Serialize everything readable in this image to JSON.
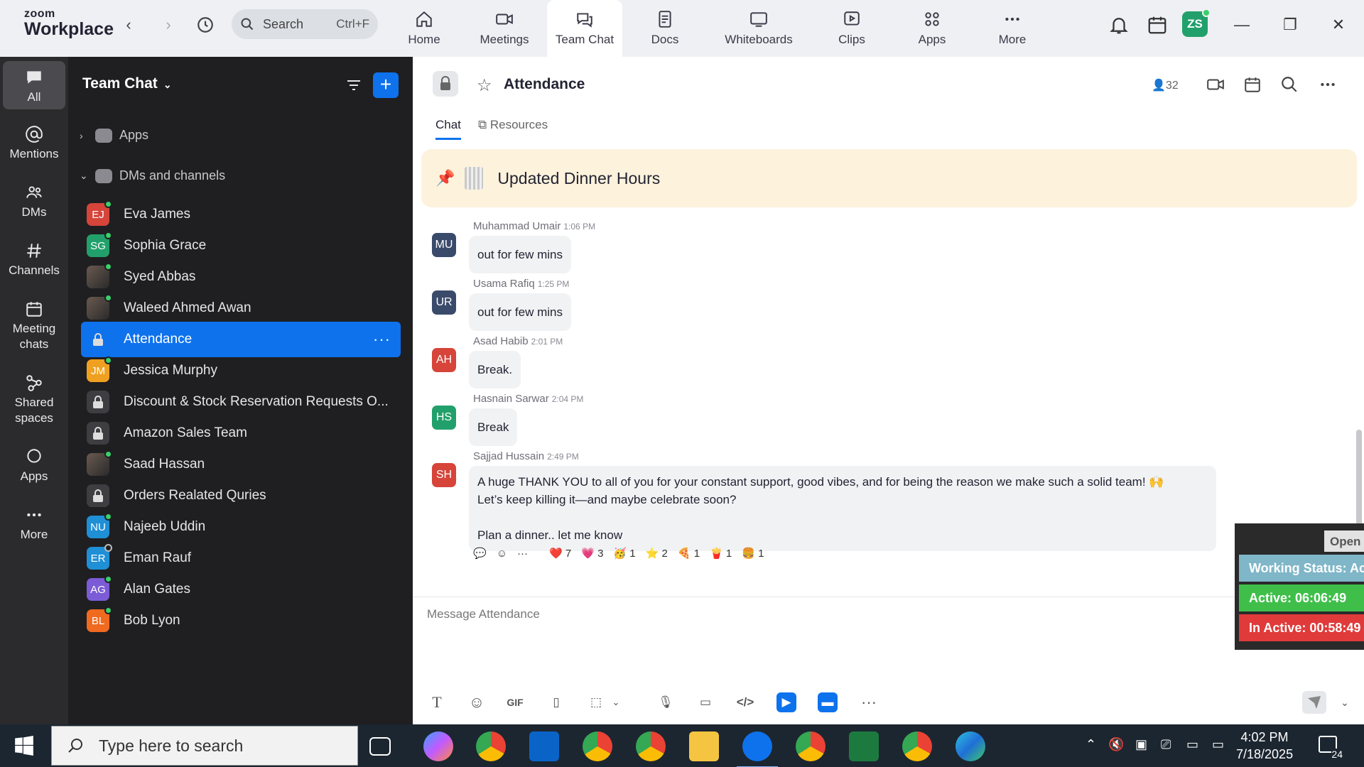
{
  "app": {
    "brand_top": "zoom",
    "brand_bottom": "Workplace"
  },
  "search": {
    "placeholder": "Search",
    "shortcut": "Ctrl+F"
  },
  "tabs": [
    {
      "label": "Home",
      "icon": "home-icon"
    },
    {
      "label": "Meetings",
      "icon": "video-camera-icon"
    },
    {
      "label": "Team Chat",
      "icon": "chat-bubble-icon",
      "active": true
    },
    {
      "label": "Docs",
      "icon": "document-icon"
    },
    {
      "label": "Whiteboards",
      "icon": "whiteboard-icon"
    },
    {
      "label": "Clips",
      "icon": "clip-icon"
    },
    {
      "label": "Apps",
      "icon": "apps-icon"
    },
    {
      "label": "More",
      "icon": "more-icon"
    }
  ],
  "user": {
    "initials": "ZS"
  },
  "rail": [
    {
      "label": "All"
    },
    {
      "label": "Mentions"
    },
    {
      "label": "DMs"
    },
    {
      "label": "Channels"
    },
    {
      "label": "Meeting chats"
    },
    {
      "label": "Shared spaces"
    },
    {
      "label": "Apps"
    },
    {
      "label": "More"
    }
  ],
  "sidebar": {
    "title": "Team Chat",
    "sections": {
      "apps": "Apps",
      "dms": "DMs and channels"
    },
    "items": [
      {
        "label": "Eva James",
        "initials": "EJ",
        "color": "#d6443a",
        "status": "online"
      },
      {
        "label": "Sophia Grace",
        "initials": "SG",
        "color": "#22a06b",
        "status": "online"
      },
      {
        "label": "Syed Abbas",
        "initials": "",
        "color": "#555",
        "status": "online",
        "photo": true
      },
      {
        "label": "Waleed Ahmed Awan",
        "initials": "",
        "color": "#555",
        "status": "online",
        "photo": true
      },
      {
        "label": "Attendance",
        "initials": "",
        "lock": true,
        "selected": true
      },
      {
        "label": "Jessica Murphy",
        "initials": "JM",
        "color": "#f0a020",
        "status": "online"
      },
      {
        "label": "Discount & Stock Reservation Requests O...",
        "initials": "",
        "lock": true
      },
      {
        "label": "Amazon Sales Team",
        "initials": "",
        "lock": true
      },
      {
        "label": "Saad Hassan",
        "initials": "",
        "color": "#555",
        "status": "online",
        "photo": true
      },
      {
        "label": "Orders Realated Quries",
        "initials": "",
        "lock": true
      },
      {
        "label": "Najeeb Uddin",
        "initials": "NU",
        "color": "#1f8fd6",
        "status": "online"
      },
      {
        "label": "Eman Rauf",
        "initials": "ER",
        "color": "#1f8fd6",
        "status": "offline"
      },
      {
        "label": "Alan Gates",
        "initials": "AG",
        "color": "#7b5cd6",
        "status": "online"
      },
      {
        "label": "Bob Lyon",
        "initials": "BL",
        "color": "#f06a20",
        "status": "online"
      }
    ]
  },
  "channel": {
    "title": "Attendance",
    "members": "32",
    "tabs": {
      "chat": "Chat",
      "resources": "Resources"
    },
    "pinned": "Updated Dinner Hours",
    "messages": [
      {
        "author": "Muhammad Umair",
        "time": "1:06 PM",
        "initials": "MU",
        "color": "#3a4a6a",
        "text": "out for few mins"
      },
      {
        "author": "Usama Rafiq",
        "time": "1:25 PM",
        "initials": "UR",
        "color": "#3a4a6a",
        "text": "out for few mins"
      },
      {
        "author": "Asad Habib",
        "time": "2:01 PM",
        "initials": "AH",
        "color": "#d6443a",
        "text": "Break."
      },
      {
        "author": "Hasnain Sarwar",
        "time": "2:04 PM",
        "initials": "HS",
        "color": "#22a06b",
        "text": "Break"
      },
      {
        "author": "Sajjad Hussain",
        "time": "2:49 PM",
        "initials": "SH",
        "color": "#d6443a",
        "line1": "A huge THANK YOU to all of you for your constant support, good vibes, and for being the reason we make such a solid team! 🙌",
        "line2": "Let’s keep killing it—and maybe celebrate soon?",
        "line3": "Plan a dinner.. let me know"
      }
    ],
    "reactions": [
      {
        "emoji": "❤️",
        "count": "7"
      },
      {
        "emoji": "💗",
        "count": "3"
      },
      {
        "emoji": "🥳",
        "count": "1"
      },
      {
        "emoji": "⭐",
        "count": "2"
      },
      {
        "emoji": "🍕",
        "count": "1"
      },
      {
        "emoji": "🍟",
        "count": "1"
      },
      {
        "emoji": "🍔",
        "count": "1"
      }
    ],
    "composer_placeholder": "Message Attendance"
  },
  "widget": {
    "open": "Open",
    "working": "Working Status: Active",
    "active": "Active: 06:06:49",
    "inactive": "In Active: 00:58:49",
    "colors": {
      "working": "#7fb6c8",
      "active": "#3fbf4a",
      "inactive": "#e03a3a"
    }
  },
  "taskbar": {
    "search_placeholder": "Type here to search",
    "time": "4:02 PM",
    "date": "7/18/2025",
    "notifications": "24"
  }
}
